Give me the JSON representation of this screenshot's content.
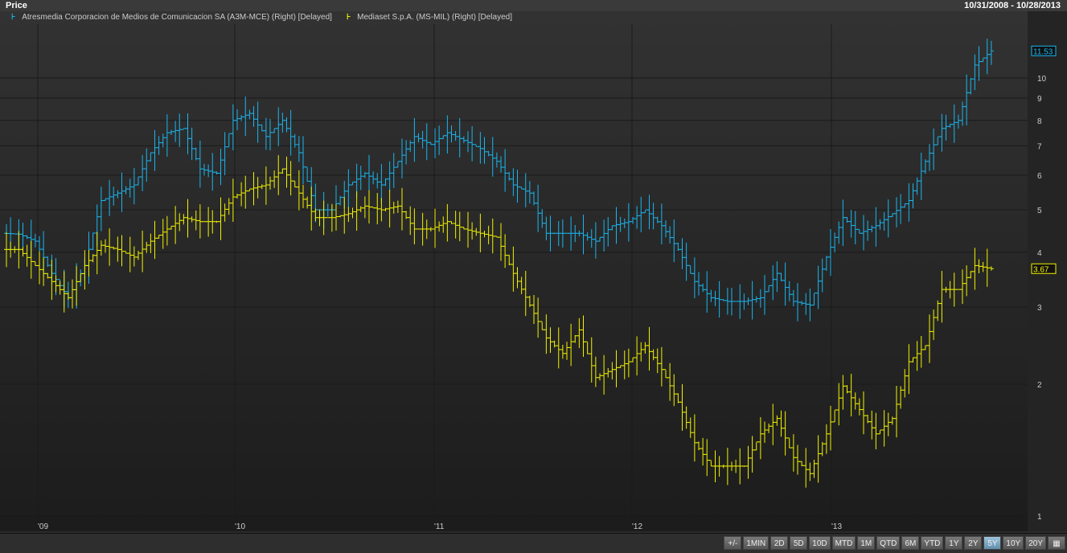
{
  "header": {
    "title": "Price",
    "date_range": "10/31/2008 - 10/28/2013"
  },
  "legend": [
    {
      "label": "Atresmedia Corporacion de Medios de Comunicacion SA (A3M-MCE) (Right) [Delayed]",
      "color": "#19b6f0"
    },
    {
      "label": "Mediaset S.p.A. (MS-MIL) (Right) [Delayed]",
      "color": "#f2f200"
    }
  ],
  "toolbar": {
    "buttons": [
      "+/-",
      "1MIN",
      "2D",
      "5D",
      "10D",
      "MTD",
      "1M",
      "QTD",
      "6M",
      "YTD",
      "1Y",
      "2Y",
      "5Y",
      "10Y",
      "20Y",
      "grid"
    ],
    "selected": "5Y"
  },
  "chart_data": {
    "type": "line",
    "scale": "log",
    "ylim": [
      1,
      12
    ],
    "yticks": [
      1,
      2,
      3,
      4,
      5,
      6,
      7,
      8,
      9,
      10
    ],
    "xticks": [
      "'09",
      "'10",
      "'11",
      "'12",
      "'13"
    ],
    "x_start": "Nov 2008",
    "x_step": "month",
    "series": [
      {
        "name": "Atresmedia (A3M-MCE)",
        "last_value": "11.53",
        "color": "#19b6f0",
        "values": [
          4.42,
          4.4,
          4.24,
          3.58,
          3.15,
          3.73,
          5.25,
          5.46,
          5.7,
          6.75,
          7.5,
          7.67,
          6.2,
          6.06,
          8.0,
          8.3,
          7.35,
          8.0,
          6.75,
          5.0,
          5.0,
          5.7,
          6.06,
          5.7,
          6.45,
          7.35,
          7.05,
          7.5,
          7.2,
          6.9,
          6.45,
          5.7,
          5.46,
          4.42,
          4.42,
          4.42,
          4.24,
          4.6,
          4.7,
          5.0,
          4.6,
          4.06,
          3.43,
          3.15,
          3.09,
          3.09,
          3.15,
          3.58,
          3.09,
          3.03,
          3.9,
          4.8,
          4.42,
          4.6,
          4.9,
          5.25,
          6.45,
          7.67,
          8.0,
          10.7,
          11.53
        ]
      },
      {
        "name": "Mediaset (MS-MIL)",
        "last_value": "3.67",
        "color": "#f2f200",
        "values": [
          4.06,
          4.06,
          3.73,
          3.43,
          3.15,
          3.73,
          4.15,
          4.06,
          3.9,
          4.24,
          4.52,
          4.8,
          4.7,
          4.7,
          5.35,
          5.58,
          5.7,
          6.2,
          5.46,
          4.8,
          4.8,
          4.9,
          5.1,
          5.0,
          5.1,
          4.52,
          4.52,
          4.7,
          4.52,
          4.42,
          4.33,
          3.58,
          3.03,
          2.55,
          2.35,
          2.66,
          2.07,
          2.16,
          2.25,
          2.45,
          2.16,
          1.82,
          1.47,
          1.3,
          1.3,
          1.3,
          1.54,
          1.67,
          1.36,
          1.25,
          1.54,
          1.98,
          1.75,
          1.54,
          1.67,
          2.25,
          2.45,
          3.29,
          3.29,
          3.73,
          3.67
        ]
      }
    ]
  }
}
